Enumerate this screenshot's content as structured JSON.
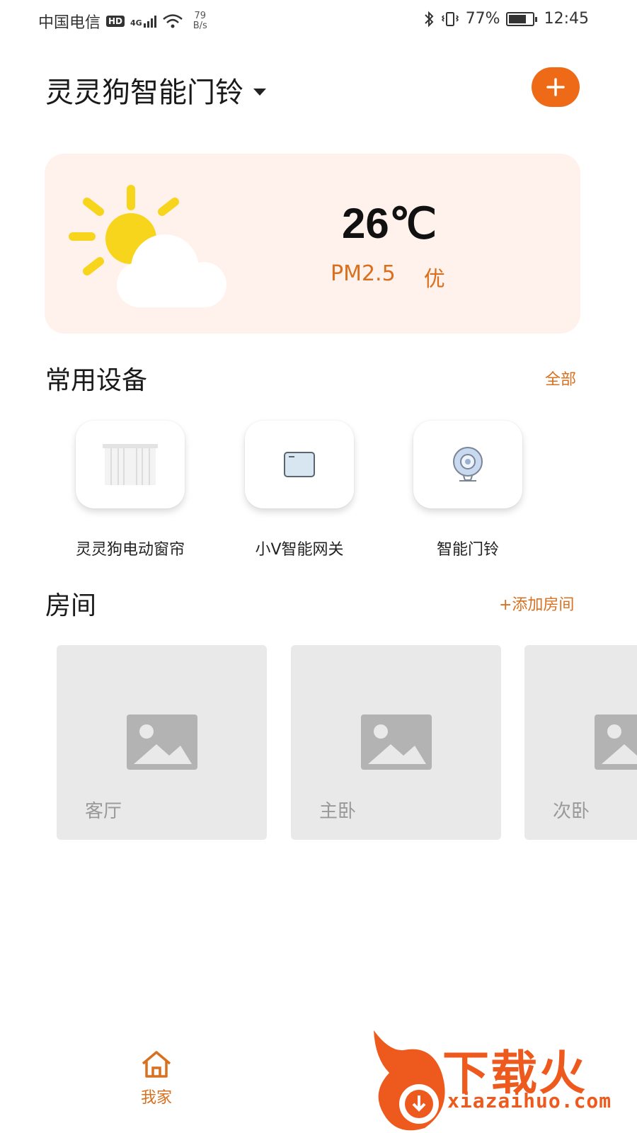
{
  "status_bar": {
    "carrier": "中国电信",
    "hd": "HD",
    "net_type": "4G",
    "net_speed_value": "79",
    "net_speed_unit": "B/s",
    "battery_percent": "77%",
    "battery_level": 0.77,
    "time": "12:45"
  },
  "header": {
    "title": "灵灵狗智能门铃",
    "add_icon": "plus-icon"
  },
  "weather": {
    "temperature": "26℃",
    "pm_label": "PM2.5",
    "pm_quality": "优",
    "icon": "sun-cloud-icon"
  },
  "devices_section": {
    "title": "常用设备",
    "link": "全部",
    "items": [
      {
        "label": "灵灵狗电动窗帘",
        "icon": "curtain-icon"
      },
      {
        "label": "小V智能网关",
        "icon": "gateway-icon"
      },
      {
        "label": "智能门铃",
        "icon": "camera-icon"
      }
    ]
  },
  "rooms_section": {
    "title": "房间",
    "link": "+添加房间",
    "items": [
      {
        "name": "客厅"
      },
      {
        "name": "主卧"
      },
      {
        "name": "次卧"
      }
    ]
  },
  "bottom_nav": {
    "home_label": "我家",
    "home_icon": "home-icon"
  },
  "watermark": {
    "brand": "下载火",
    "url": "xiazaihuo.com"
  },
  "colors": {
    "accent": "#ef6a17",
    "accent_text": "#d8701f",
    "weather_card_bg": "#fff1eb",
    "room_bg": "#e9e9e9"
  }
}
